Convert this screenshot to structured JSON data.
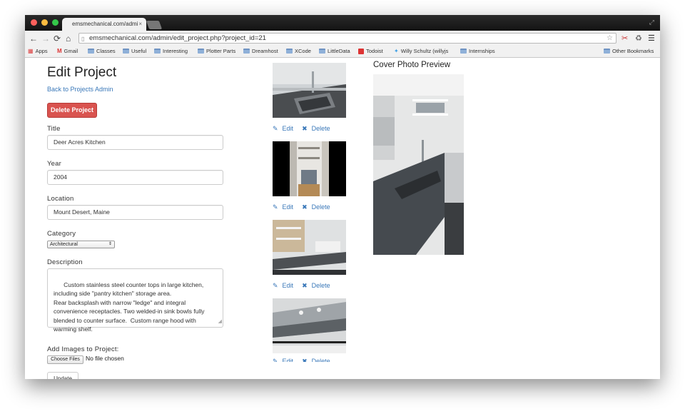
{
  "browser": {
    "tab_title": "emsmechanical.com/admi",
    "tab_close": "×",
    "url": "emsmechanical.com/admin/edit_project.php?project_id=21",
    "colors": {
      "close": "#fc605c",
      "minimize": "#fdbc40",
      "zoom": "#34c84a"
    },
    "icons": [
      "back-icon",
      "forward-icon",
      "reload-icon",
      "home-icon",
      "page-icon",
      "star-icon",
      "extension-icon",
      "recycle-icon",
      "menu-icon"
    ],
    "nav": {
      "back": "←",
      "forward": "→",
      "reload": "⟳",
      "home": "⌂",
      "star": "☆",
      "menu": "☰",
      "recycle": "♻",
      "ext": "✂"
    }
  },
  "bookmarks": {
    "items": [
      {
        "label": "Apps",
        "icon": "apps-grid-icon"
      },
      {
        "label": "Gmail",
        "icon": "gmail-icon"
      },
      {
        "label": "Classes",
        "icon": "folder-icon"
      },
      {
        "label": "Useful",
        "icon": "folder-icon"
      },
      {
        "label": "Interesting",
        "icon": "folder-icon"
      },
      {
        "label": "Plotter Parts",
        "icon": "folder-icon"
      },
      {
        "label": "Dreamhost",
        "icon": "folder-icon"
      },
      {
        "label": "XCode",
        "icon": "folder-icon"
      },
      {
        "label": "LittleData",
        "icon": "folder-icon"
      },
      {
        "label": "Todoist",
        "icon": "todoist-icon"
      },
      {
        "label": "Willy Schultz (willyjs",
        "icon": "twitter-icon"
      },
      {
        "label": "Internships",
        "icon": "folder-icon"
      }
    ],
    "other": "Other Bookmarks"
  },
  "page": {
    "heading": "Edit Project",
    "back_link": "Back to Projects Admin",
    "delete_button": "Delete Project",
    "fields": {
      "title_label": "Title",
      "title_value": "Deer Acres Kitchen",
      "year_label": "Year",
      "year_value": "2004",
      "location_label": "Location",
      "location_value": "Mount Desert, Maine",
      "category_label": "Category",
      "category_value": "Architectural",
      "description_label": "Description",
      "description_value": "Custom stainless steel counter tops in large kitchen,\nincluding side \"pantry kitchen\" storage area.\nRear backsplash with narrow \"ledge\" and integral\nconvenience receptacles. Two welded-in sink bowls fully\nblended to counter surface.  Custom range hood with\nwarming shelf.",
      "images_label": "Add Images to Project:",
      "file_button": "Choose Files",
      "file_status": "No file chosen",
      "update_button": "Update"
    },
    "images": {
      "edit_label": "Edit",
      "delete_label": "Delete",
      "edit_icon": "pencil-icon",
      "delete_icon": "x-icon"
    },
    "cover_title": "Cover Photo Preview"
  }
}
